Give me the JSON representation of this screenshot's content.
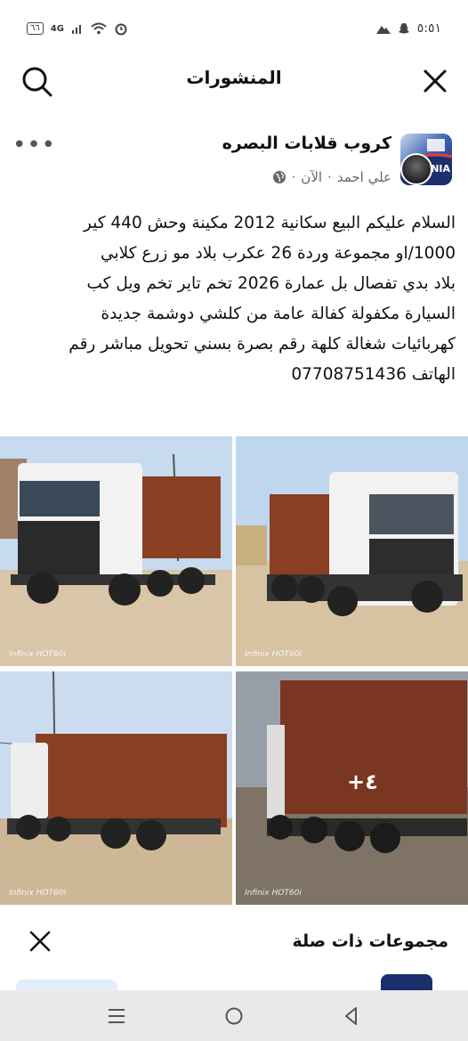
{
  "status_bar": {
    "time": "٥:٥١",
    "network": "4G",
    "battery": "٦٦"
  },
  "header": {
    "title": "المنشورات"
  },
  "post": {
    "group_name": "كروب قلابات البصره",
    "author": "علي احمد",
    "time": "الآن",
    "separator": "·",
    "text_lines": [
      "السلام عليكم البيع سكانية 2012 مكينة وحش 440 كير",
      "1000/او  مجموعة وردة 26 عكرب بلاد مو زرع  كلابي",
      "بلاد بدي تفصال بل عمارة 2026 تخم تاير تخم ويل كب",
      "السيارة مكفولة كفالة عامة من كلشي دوشمة جديدة",
      "كهربائيات شغالة كلهة  رقم بصرة بسني تحويل مباشر رقم",
      "الهاتف 07708751436"
    ],
    "photo_watermark": "Infinix HOT60i",
    "more_photos": "+٤",
    "group_avatar_label": "NIA"
  },
  "related": {
    "title": "مجموعات ذات صلة"
  },
  "colors": {
    "dump_body": "#8a3f22",
    "cab": "#f2f2f2",
    "sky": "#c6daf0",
    "ground": "#d9c5a7"
  }
}
